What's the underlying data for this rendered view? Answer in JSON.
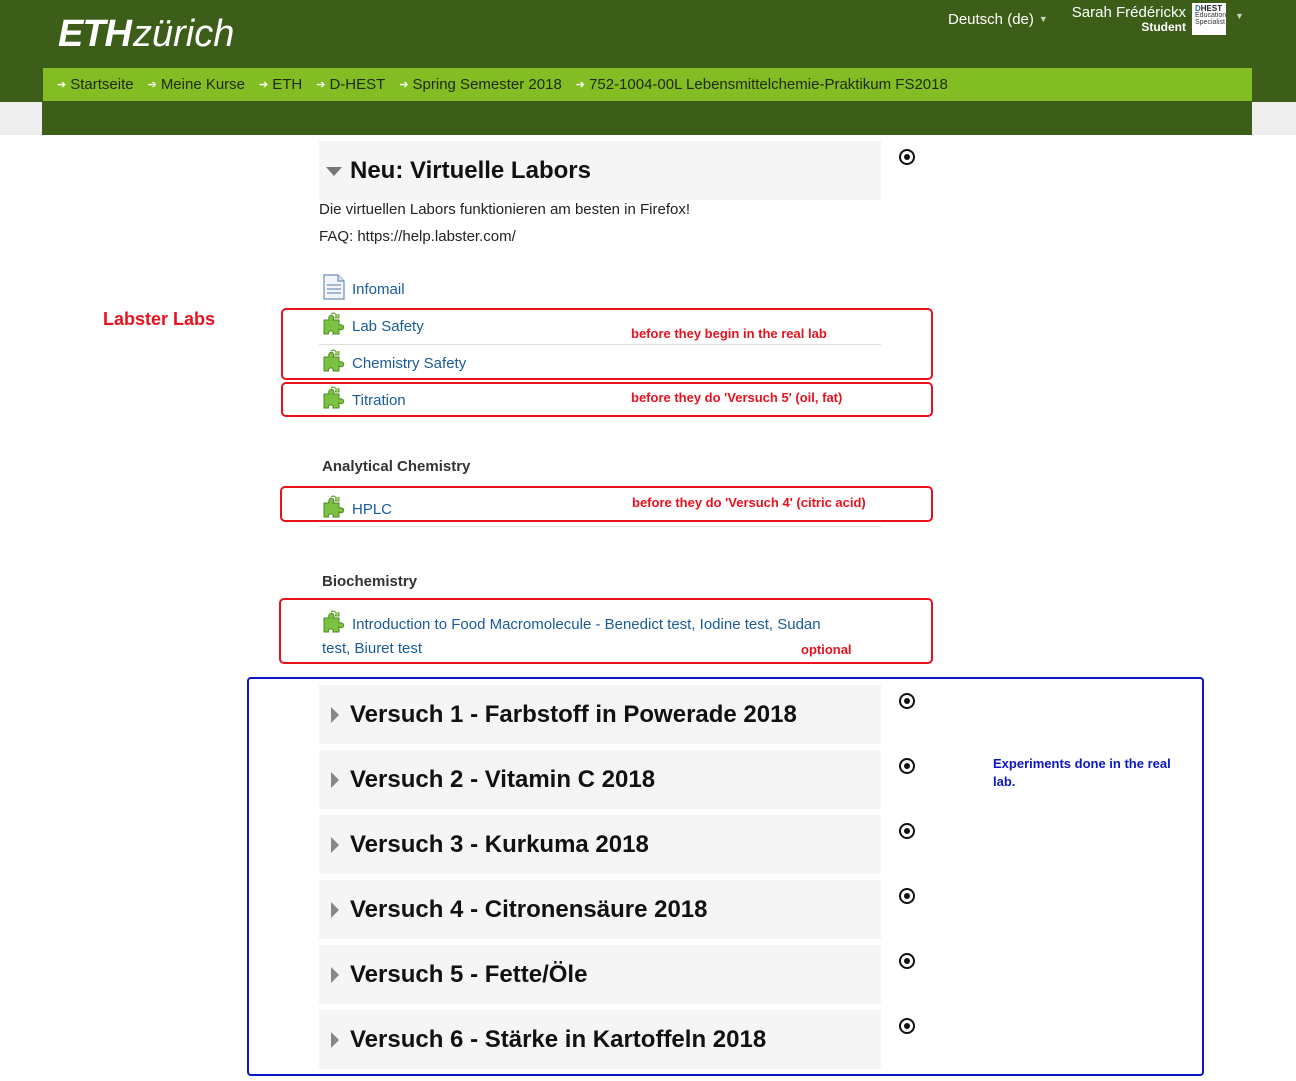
{
  "header": {
    "logo_eth": "ETH",
    "logo_zurich": "zürich",
    "language": "Deutsch (de)",
    "user_name": "Sarah Frédérickx",
    "user_role": "Student",
    "badge_line1_d": "D",
    "badge_line1_rest": "HEST",
    "badge_line2": "Education",
    "badge_line3": "Specialist"
  },
  "breadcrumb": [
    {
      "label": "Startseite"
    },
    {
      "label": "Meine Kurse"
    },
    {
      "label": "ETH"
    },
    {
      "label": "D-HEST"
    },
    {
      "label": "Spring Semester 2018"
    },
    {
      "label": "752-1004-00L Lebensmittelchemie-Praktikum FS2018"
    }
  ],
  "virtual_labs": {
    "title": "Neu: Virtuelle Labors",
    "info_line1": "Die virtuellen Labors funktionieren am besten in Firefox!",
    "info_line2": "FAQ: https://help.labster.com/",
    "infomail": "Infomail",
    "lab_safety": "Lab Safety",
    "chemistry_safety": "Chemistry Safety",
    "titration": "Titration",
    "category_analytical": "Analytical Chemistry",
    "hplc": "HPLC",
    "category_biochemistry": "Biochemistry",
    "food_macromolecule_line1": "Introduction to Food Macromolecule - Benedict test, Iodine test, Sudan",
    "food_macromolecule_line2": "test, Biuret test"
  },
  "annotations": {
    "labster_labs": "Labster Labs",
    "before_real_lab": "before they begin in the real lab",
    "before_versuch5": "before they do 'Versuch 5' (oil, fat)",
    "before_versuch4": "before they do 'Versuch 4' (citric acid)",
    "optional": "optional",
    "experiments_real_lab_line1": "Experiments done in the real",
    "experiments_real_lab_line2": "lab.",
    "red_color": "#e8121f",
    "blue_color": "#0a16c8"
  },
  "sections": [
    {
      "title": "Versuch 1 - Farbstoff in Powerade 2018"
    },
    {
      "title": "Versuch 2 - Vitamin C 2018"
    },
    {
      "title": "Versuch 3 - Kurkuma 2018"
    },
    {
      "title": "Versuch 4 - Citronensäure 2018"
    },
    {
      "title": "Versuch 5 - Fette/Öle"
    },
    {
      "title": "Versuch 6 - Stärke in Kartoffeln 2018"
    }
  ],
  "colors": {
    "header_dark_green": "#3d5e19",
    "breadcrumb_green": "#82bd23",
    "link_blue": "#1a5b9a",
    "puzzle_green": "#7cc242"
  },
  "icons": {
    "section_toggle": "target-icon",
    "activity": "puzzle-icon",
    "resource": "document-icon"
  }
}
